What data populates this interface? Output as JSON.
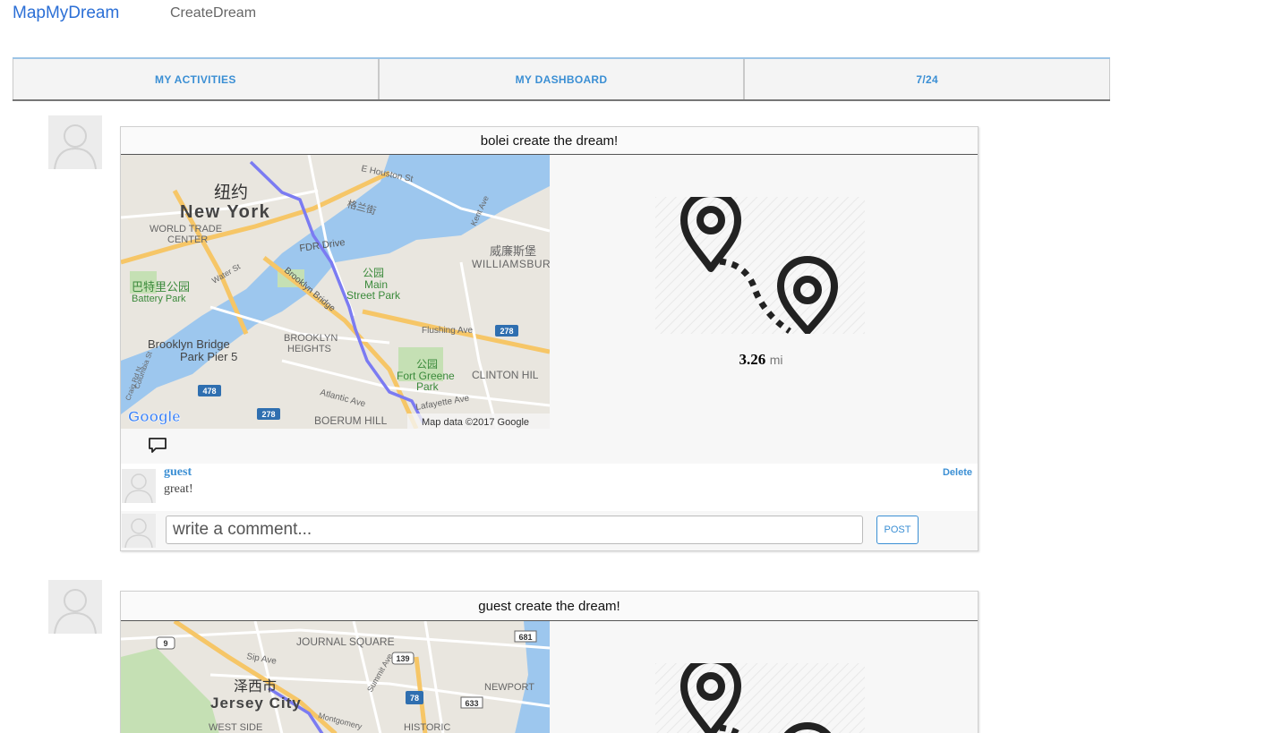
{
  "header": {
    "brand": "MapMyDream",
    "create_link": "CreateDream"
  },
  "tabs": [
    {
      "label": "MY ACTIVITIES"
    },
    {
      "label": "MY DASHBOARD"
    },
    {
      "label": "7/24"
    }
  ],
  "posts": [
    {
      "title": "bolei create the dream!",
      "distance_value": "3.26",
      "distance_unit": "mi",
      "map": {
        "labels": [
          "纽约",
          "New York",
          "WORLD TRADE",
          "CENTER",
          "FDR Drive",
          "公园",
          "Main",
          "Street Park",
          "威廉斯堡",
          "WILLIAMSBUR",
          "巴特里公园",
          "Battery Park",
          "Water St",
          "Brooklyn Bridge",
          "BROOKLYN",
          "HEIGHTS",
          "Flushing Ave",
          "Brooklyn Bridge",
          "Park Pier 5",
          "公园",
          "Fort Greene",
          "Park",
          "CLINTON HIL",
          "Atlantic Ave",
          "Lafayette Ave",
          "BOERUM HILL",
          "E Houston St",
          "格兰街",
          "Kent Ave",
          "Craig Rd N",
          "Columbia St"
        ],
        "shields": [
          "278",
          "478",
          "278"
        ],
        "google_logo": "Google",
        "attribution": "Map data ©2017 Google"
      },
      "comments": [
        {
          "user": "guest",
          "text": "great!",
          "delete_label": "Delete"
        }
      ],
      "comment_placeholder": "write a comment...",
      "post_label": "POST"
    },
    {
      "title": "guest create the dream!",
      "map": {
        "labels": [
          "JOURNAL SQUARE",
          "Sip Ave",
          "泽西市",
          "Jersey City",
          "NEWPORT",
          "Montgomery",
          "WEST SIDE",
          "HISTORIC",
          "Summit Ave"
        ],
        "shields": [
          "9",
          "139",
          "78",
          "681",
          "633"
        ]
      }
    }
  ],
  "colors": {
    "brand": "#2b6fd6",
    "accent": "#3b8fd4",
    "route": "#7b7bf2",
    "water": "#9dc7ee"
  }
}
